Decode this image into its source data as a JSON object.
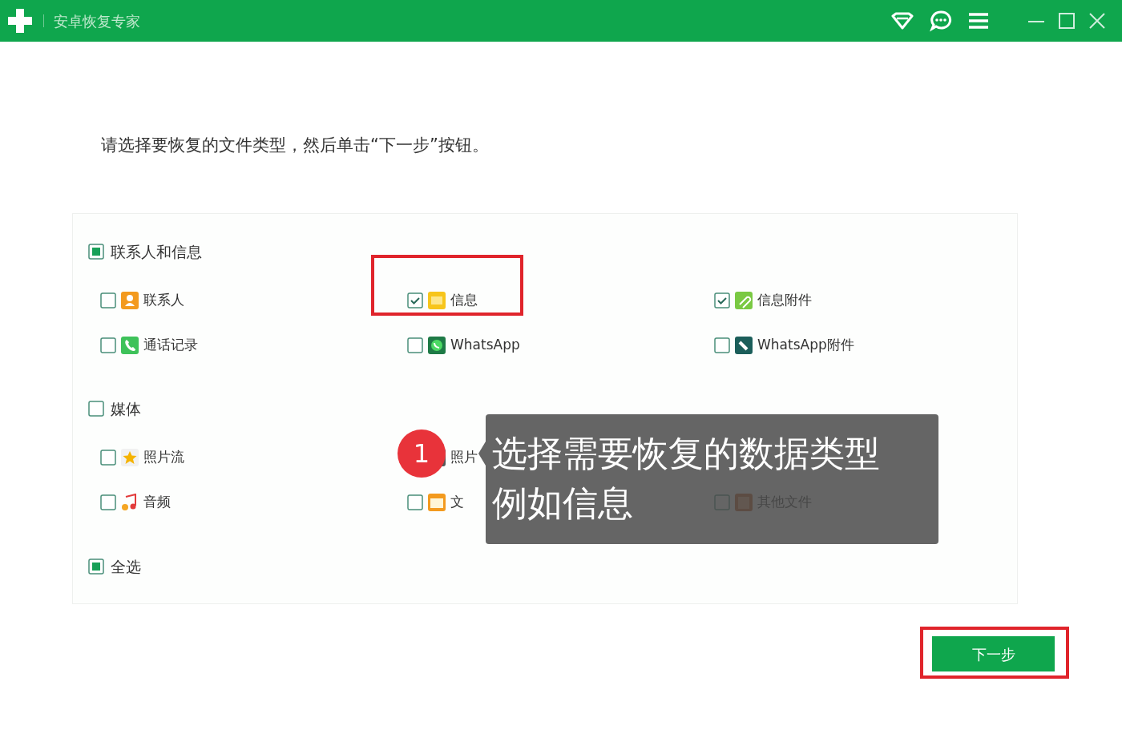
{
  "window": {
    "title": "安卓恢复专家"
  },
  "instruction": "请选择要恢复的文件类型，然后单击“下一步”按钮。",
  "groups": [
    {
      "label": "联系人和信息",
      "checked": false,
      "mixed": true,
      "rows": [
        [
          {
            "kind": "contacts",
            "label": "联系人",
            "checked": false,
            "highlighted": false
          },
          {
            "kind": "messages",
            "label": "信息",
            "checked": true,
            "highlighted": true
          },
          {
            "kind": "attachments",
            "label": "信息附件",
            "checked": true,
            "highlighted": false
          }
        ],
        [
          {
            "kind": "calls",
            "label": "通话记录",
            "checked": false,
            "highlighted": false
          },
          {
            "kind": "whatsapp",
            "label": "WhatsApp",
            "checked": false,
            "highlighted": false
          },
          {
            "kind": "whatsapp-attachments",
            "label": "WhatsApp附件",
            "checked": false,
            "highlighted": false
          }
        ]
      ]
    },
    {
      "label": "媒体",
      "checked": false,
      "mixed": false,
      "rows": [
        [
          {
            "kind": "photostream",
            "label": "照片流",
            "checked": false,
            "highlighted": false
          },
          {
            "kind": "photos",
            "label": "照片",
            "highlighted": false
          }
        ],
        [
          {
            "kind": "audio",
            "label": "音频",
            "checked": false,
            "highlighted": false
          },
          {
            "kind": "documents",
            "label": "文",
            "checked": false,
            "highlighted": false
          },
          {
            "kind": "other",
            "label": "其他文件",
            "checked": false,
            "highlighted": false
          }
        ]
      ]
    }
  ],
  "select_all": {
    "label": "全选",
    "checked": false,
    "mixed": true
  },
  "next_button": {
    "label": "下一步",
    "highlighted": true
  },
  "callout": {
    "badge": "1",
    "lines": [
      "选择需要恢复的数据类型",
      "例如信息"
    ]
  }
}
